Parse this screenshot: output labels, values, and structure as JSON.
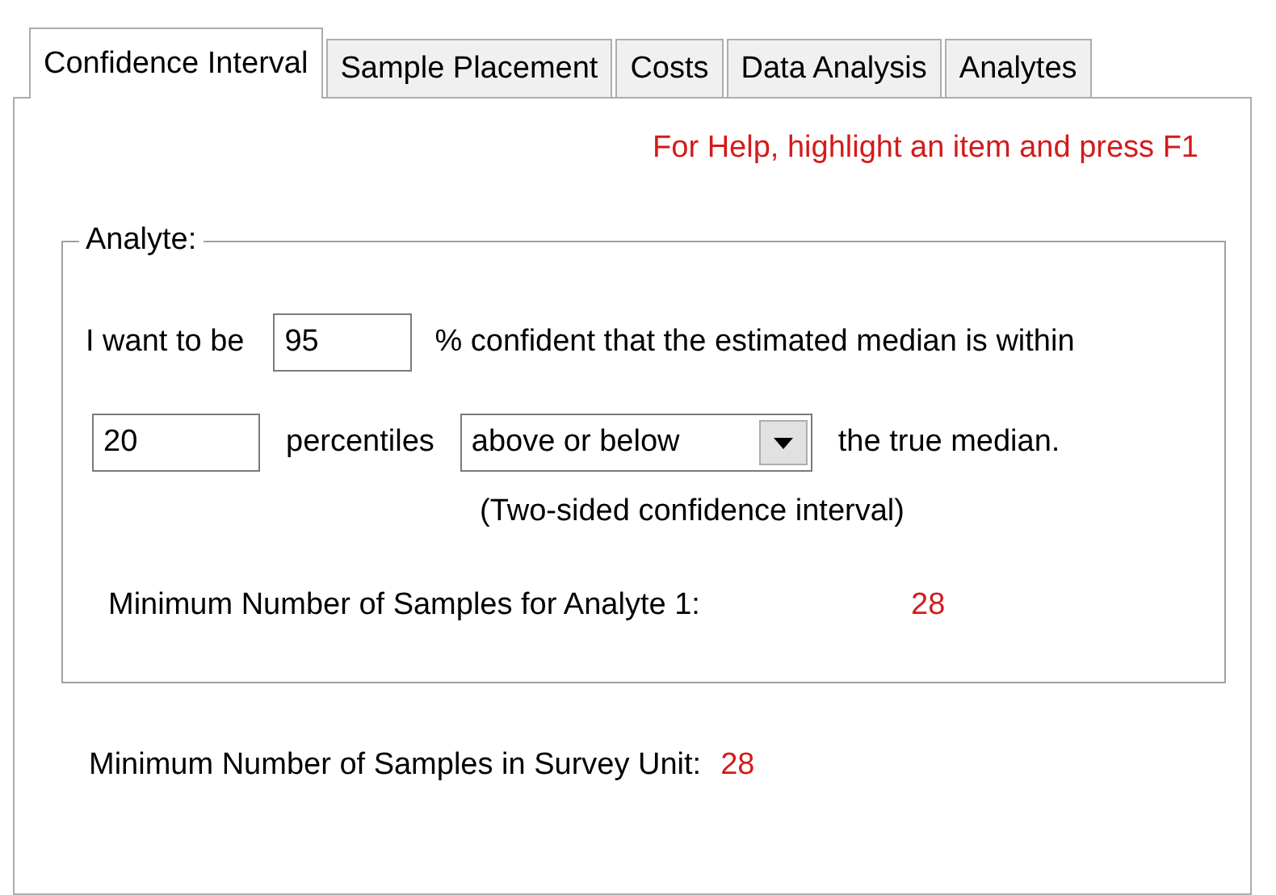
{
  "tabs": [
    {
      "label": "Confidence Interval",
      "selected": true
    },
    {
      "label": "Sample Placement",
      "selected": false
    },
    {
      "label": "Costs",
      "selected": false
    },
    {
      "label": "Data Analysis",
      "selected": false
    },
    {
      "label": "Analytes",
      "selected": false
    }
  ],
  "help_text": "For Help, highlight an item and press F1",
  "analyte_group": {
    "legend": "Analyte:",
    "confidence_prefix": "I want to be",
    "confidence_value": "95",
    "confidence_suffix": "% confident that the estimated median is within",
    "percentiles_value": "20",
    "percentiles_label": "percentiles",
    "direction": "above or below",
    "true_median_label": "the true median.",
    "note": "(Two-sided confidence interval)",
    "min_label": "Minimum Number of Samples for Analyte 1:",
    "min_value": "28"
  },
  "survey_unit": {
    "min_label": "Minimum Number of Samples in Survey Unit:",
    "min_value": "28"
  }
}
